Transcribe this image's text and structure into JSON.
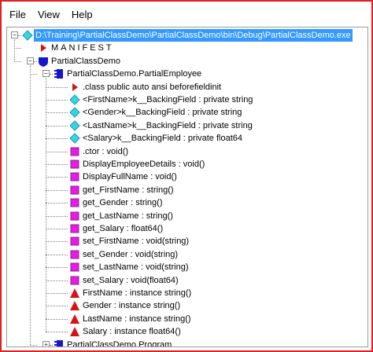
{
  "colors": {
    "frame_border": "#e02020",
    "selection": "#3399ff",
    "cyan_diamond": "#35d4e8",
    "magenta_method": "#e020e0",
    "red_property": "#d41515",
    "blue_class": "#1515d0"
  },
  "menu": {
    "file": "File",
    "view": "View",
    "help": "Help"
  },
  "tree": [
    {
      "label": "D:\\Training\\PartialClassDemo\\PartialClassDemo\\bin\\Debug\\PartialClassDemo.exe",
      "icon": "assembly-diamond-icon",
      "expander": "minus",
      "level": 0,
      "selected": true
    },
    {
      "label": "MANIFEST",
      "icon": "manifest-triangle-icon",
      "level": 1
    },
    {
      "label": "PartialClassDemo",
      "icon": "namespace-shield-icon",
      "expander": "minus",
      "level": 1
    },
    {
      "label": "PartialClassDemo.PartialEmployee",
      "icon": "class-icon",
      "expander": "minus",
      "level": 2
    },
    {
      "label": ".class public auto ansi beforefieldinit",
      "icon": "class-info-triangle-icon",
      "level": 3
    },
    {
      "label": "<FirstName>k__BackingField : private string",
      "icon": "field-diamond-icon",
      "level": 3
    },
    {
      "label": "<Gender>k__BackingField : private string",
      "icon": "field-diamond-icon",
      "level": 3
    },
    {
      "label": "<LastName>k__BackingField : private string",
      "icon": "field-diamond-icon",
      "level": 3
    },
    {
      "label": "<Salary>k__BackingField : private float64",
      "icon": "field-diamond-icon",
      "level": 3
    },
    {
      "label": ".ctor : void()",
      "icon": "method-square-icon",
      "level": 3
    },
    {
      "label": "DisplayEmployeeDetails : void()",
      "icon": "method-square-icon",
      "level": 3
    },
    {
      "label": "DisplayFullName : void()",
      "icon": "method-square-icon",
      "level": 3
    },
    {
      "label": "get_FirstName : string()",
      "icon": "method-square-icon",
      "level": 3
    },
    {
      "label": "get_Gender : string()",
      "icon": "method-square-icon",
      "level": 3
    },
    {
      "label": "get_LastName : string()",
      "icon": "method-square-icon",
      "level": 3
    },
    {
      "label": "get_Salary : float64()",
      "icon": "method-square-icon",
      "level": 3
    },
    {
      "label": "set_FirstName : void(string)",
      "icon": "method-square-icon",
      "level": 3
    },
    {
      "label": "set_Gender : void(string)",
      "icon": "method-square-icon",
      "level": 3
    },
    {
      "label": "set_LastName : void(string)",
      "icon": "method-square-icon",
      "level": 3
    },
    {
      "label": "set_Salary : void(float64)",
      "icon": "method-square-icon",
      "level": 3
    },
    {
      "label": "FirstName : instance string()",
      "icon": "property-triangle-icon",
      "level": 3
    },
    {
      "label": "Gender : instance string()",
      "icon": "property-triangle-icon",
      "level": 3
    },
    {
      "label": "LastName : instance string()",
      "icon": "property-triangle-icon",
      "level": 3
    },
    {
      "label": "Salary : instance float64()",
      "icon": "property-triangle-icon",
      "level": 3
    },
    {
      "label": "PartialClassDemo.Program",
      "icon": "class-icon",
      "expander": "plus",
      "level": 2
    }
  ]
}
